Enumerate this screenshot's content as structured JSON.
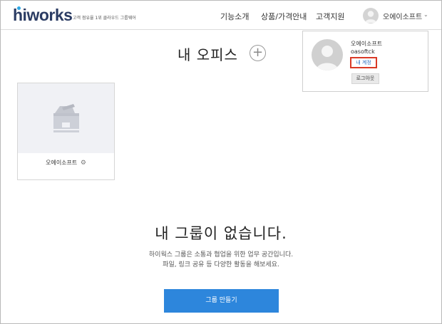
{
  "header": {
    "logo": "hiworks",
    "tagline": "고객 점유율 1위 클라우드 그룹웨어",
    "nav": [
      "기능소개",
      "상품/가격안내",
      "고객지원"
    ],
    "user_name": "오에이소프트",
    "chevron": "⌄"
  },
  "main": {
    "office_title": "내 오피스",
    "add_icon": "+",
    "office_card": {
      "name": "오에이소프트",
      "settings_icon": "gear-icon"
    },
    "empty_title": "내 그룹이 없습니다.",
    "empty_desc_line1": "하이웍스 그룹은 소통과 협업을 위한 업무 공간입니다.",
    "empty_desc_line2": "파일, 링크 공유 등 다양한 활동을 해보세요.",
    "create_group_label": "그룹 만들기"
  },
  "profile_popup": {
    "name": "오에이소프트",
    "id": "oasoftck",
    "my_account_label": "내 계정",
    "logout_label": "로그아웃"
  },
  "colors": {
    "accent": "#2d86dc",
    "highlight": "#d93a26",
    "logo_dot": "#2ea8e5"
  }
}
